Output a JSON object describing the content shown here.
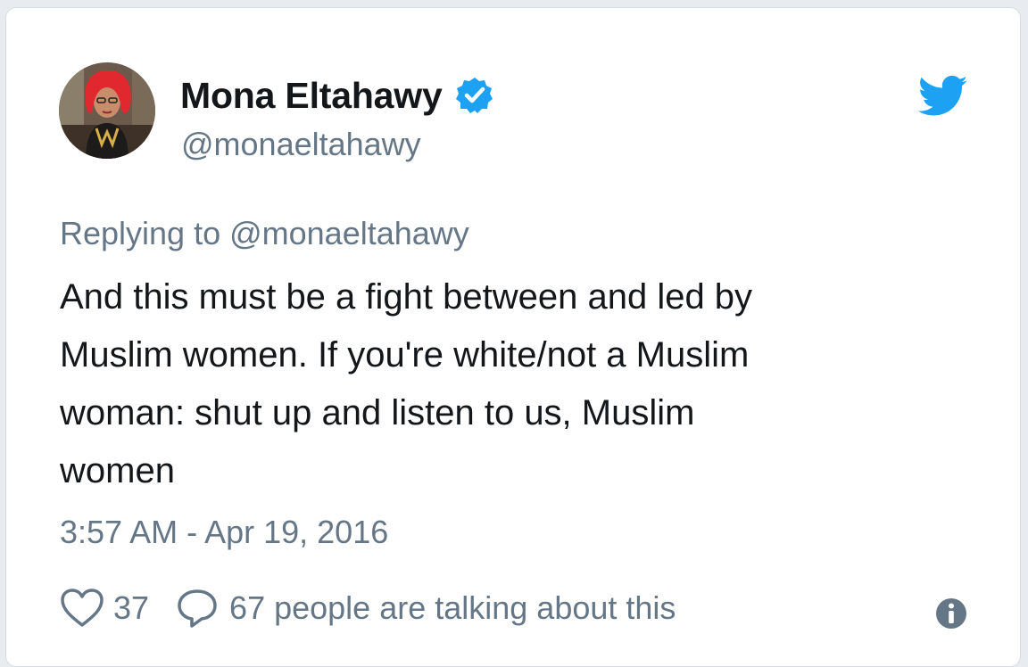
{
  "tweet": {
    "author": {
      "display_name": "Mona Eltahawy",
      "handle": "@monaeltahawy",
      "verified": true
    },
    "replying_to": "Replying to @monaeltahawy",
    "text_lines": [
      "And this must be a fight between and led by",
      "Muslim women. If you're white/not a Muslim",
      "woman: shut up and listen to us, Muslim",
      "women"
    ],
    "timestamp": "3:57 AM - Apr 19, 2016",
    "like_count": "37",
    "talking_text": "67 people are talking about this"
  },
  "icons": {
    "brand": "twitter-bird-icon",
    "verified": "verified-badge-icon",
    "like": "heart-icon",
    "reply": "reply-bubble-icon",
    "info": "info-icon"
  },
  "colors": {
    "twitter_blue": "#1da1f2",
    "text_primary": "#14171a",
    "text_secondary": "#657786",
    "page_background": "#e8ecf0",
    "card_background": "#ffffff",
    "avatar_hair": "#e0282e"
  }
}
